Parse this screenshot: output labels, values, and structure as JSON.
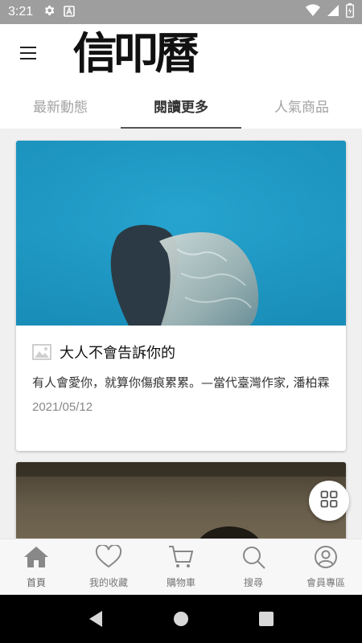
{
  "status_bar": {
    "time": "3:21",
    "icons": [
      "settings-icon",
      "a-notification-icon",
      "wifi-icon",
      "cell-signal-icon",
      "battery-icon"
    ]
  },
  "app_bar": {
    "menu_icon": "hamburger-menu-icon",
    "logo_text": "信叩曆"
  },
  "tabs": [
    {
      "label": "最新動態",
      "active": false
    },
    {
      "label": "閱讀更多",
      "active": true
    },
    {
      "label": "人氣商品",
      "active": false
    }
  ],
  "cards": [
    {
      "image": "underwater-person-photo",
      "type_icon": "image-icon",
      "title": "大人不會告訴你的",
      "description": "有人會愛你，就算你傷痕累累。—當代臺灣作家, 潘柏霖",
      "date": "2021/05/12"
    },
    {
      "image": "dark-room-person-photo"
    }
  ],
  "fab": {
    "icon": "grid-icon"
  },
  "bottom_nav": [
    {
      "label": "首頁",
      "icon": "home-icon",
      "active": true
    },
    {
      "label": "我的收藏",
      "icon": "heart-icon",
      "active": false
    },
    {
      "label": "購物車",
      "icon": "cart-icon",
      "active": false
    },
    {
      "label": "搜尋",
      "icon": "search-icon",
      "active": false
    },
    {
      "label": "會員專區",
      "icon": "user-icon",
      "active": false
    }
  ],
  "system_nav": [
    "back-icon",
    "home-circle-icon",
    "recents-icon"
  ],
  "colors": {
    "status_bar": "#9e9e9e",
    "water": "#1f9bc6",
    "content_bg": "#f0f0f0",
    "bottom_nav_bg": "#f7f7f7"
  }
}
